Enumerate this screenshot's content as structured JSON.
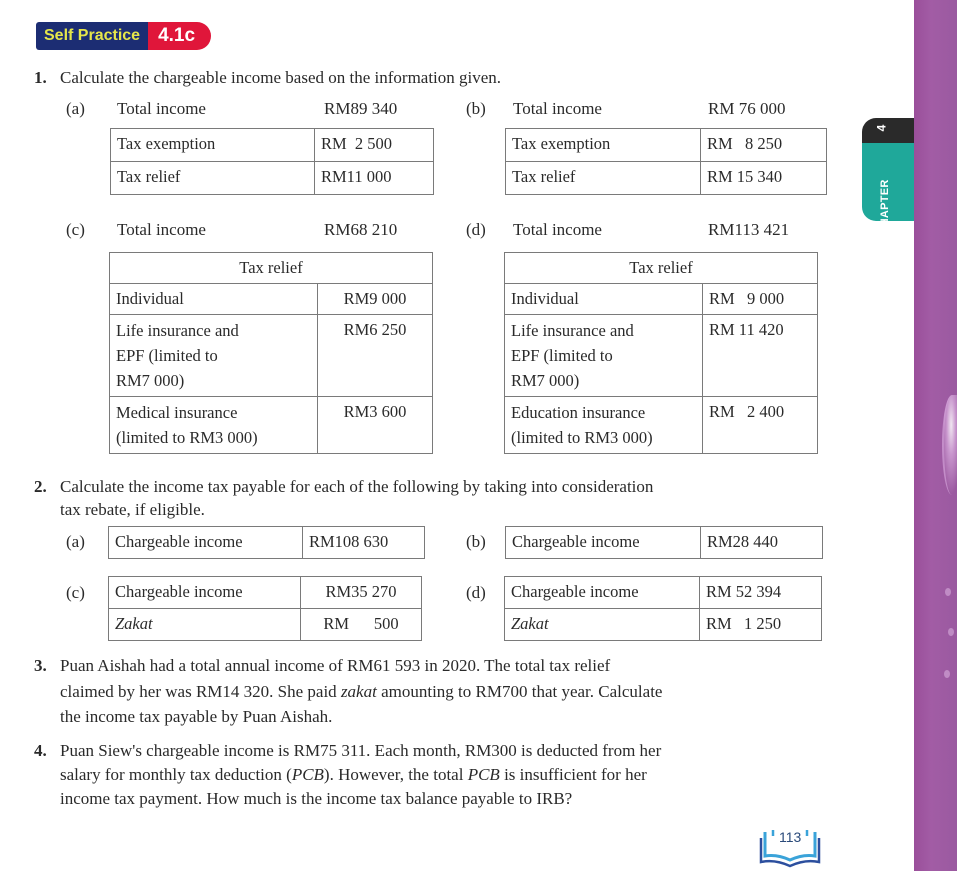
{
  "header": {
    "badge_label": "Self Practice",
    "badge_code": "4.1c"
  },
  "chapter_tab": {
    "word": "CHAPTER",
    "number": "4"
  },
  "q1": {
    "number": "1.",
    "prompt": "Calculate the chargeable income based on the information given.",
    "a": {
      "label": "(a)",
      "total_label": "Total income",
      "total_value": "RM89 340",
      "rows": [
        {
          "k": "Tax exemption",
          "v": "RM  2 500"
        },
        {
          "k": "Tax relief",
          "v": "RM11 000"
        }
      ]
    },
    "b": {
      "label": "(b)",
      "total_label": "Total income",
      "total_value": "RM 76 000",
      "rows": [
        {
          "k": "Tax exemption",
          "v": "RM   8 250"
        },
        {
          "k": "Tax relief",
          "v": "RM 15 340"
        }
      ]
    },
    "c": {
      "label": "(c)",
      "total_label": "Total income",
      "total_value": "RM68 210",
      "header": "Tax relief",
      "rows": [
        {
          "k1": "Life insurance and",
          "k": "Individual",
          "v": "RM9 000"
        },
        {
          "k1": "Life insurance and",
          "k2": "EPF (limited to",
          "k3": "RM7 000)",
          "v": "RM6 250"
        },
        {
          "k1": "Medical insurance",
          "k2": "(limited to RM3 000)",
          "v": "RM3 600"
        }
      ]
    },
    "d": {
      "label": "(d)",
      "total_label": "Total income",
      "total_value": "RM113 421",
      "header": "Tax relief",
      "rows": [
        {
          "k": "Individual",
          "v": "RM   9 000"
        },
        {
          "k1": "Life insurance and",
          "k2": "EPF (limited to",
          "k3": "RM7 000)",
          "v": "RM 11 420"
        },
        {
          "k1": "Education insurance",
          "k2": "(limited to RM3 000)",
          "v": "RM   2 400"
        }
      ]
    }
  },
  "q2": {
    "number": "2.",
    "prompt_line1": "Calculate the income tax payable for each of the following by taking into consideration",
    "prompt_line2": "tax rebate, if eligible.",
    "a": {
      "label": "(a)",
      "k": "Chargeable income",
      "v": "RM108 630"
    },
    "b": {
      "label": "(b)",
      "k": "Chargeable income",
      "v": "RM28 440"
    },
    "c": {
      "label": "(c)",
      "k": "Chargeable income",
      "v": "RM35 270",
      "k2": "Zakat",
      "v2": "RM      500"
    },
    "d": {
      "label": "(d)",
      "k": "Chargeable income",
      "v": "RM 52 394",
      "k2": "Zakat",
      "v2": "RM   1 250"
    }
  },
  "q3": {
    "number": "3.",
    "line1": "Puan Aishah had a total annual income of RM61 593 in 2020. The total tax relief",
    "line2_a": "claimed by her was RM14 320. She paid ",
    "line2_it": "zakat",
    "line2_b": " amounting to RM700 that year. Calculate",
    "line3": "the income tax payable by Puan Aishah."
  },
  "q4": {
    "number": "4.",
    "line1": "Puan Siew's chargeable income is RM75 311. Each month, RM300 is deducted from her",
    "line2_a": "salary for monthly tax deduction (",
    "line2_it1": "PCB",
    "line2_b": "). However, the total ",
    "line2_it2": "PCB",
    "line2_c": " is insufficient for her",
    "line3": "income tax payment. How much is the income tax balance payable to IRB?"
  },
  "footer": {
    "page_number": "113"
  },
  "colors": {
    "badge_blue": "#1c2d73",
    "badge_yellow": "#e6e64a",
    "badge_red": "#e0163a",
    "chapter_teal": "#1fa89a",
    "edge_purple": "#a25ca5"
  }
}
